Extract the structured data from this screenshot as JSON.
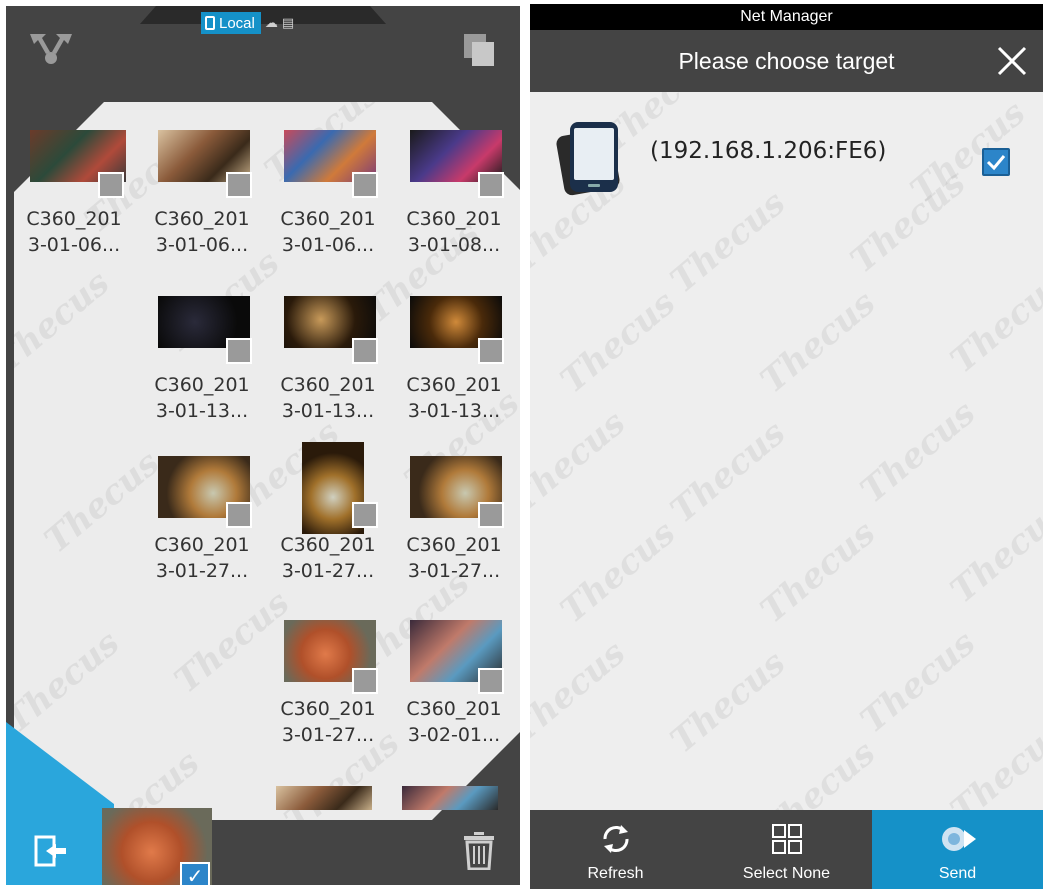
{
  "left_panel": {
    "source_tabs": {
      "local_label": "Local"
    },
    "thumbnails": [
      {
        "label": "C360_201\n3-01-06..."
      },
      {
        "label": "C360_201\n3-01-06..."
      },
      {
        "label": "C360_201\n3-01-06..."
      },
      {
        "label": "C360_201\n3-01-08..."
      },
      {
        "label": "C360_201\n3-01-13..."
      },
      {
        "label": "C360_201\n3-01-13..."
      },
      {
        "label": "C360_201\n3-01-13..."
      },
      {
        "label": "C360_201\n3-01-27..."
      },
      {
        "label": "C360_201\n3-01-27..."
      },
      {
        "label": "C360_201\n3-01-27..."
      },
      {
        "label": "C360_201\n3-01-27..."
      },
      {
        "label": "C360_201\n3-02-01..."
      }
    ],
    "accent_color": "#1591c8"
  },
  "right_panel": {
    "status_bar_title": "Net Manager",
    "dialog_title": "Please choose target",
    "devices": [
      {
        "address": "(192.168.1.206:FE6)",
        "checked": true
      }
    ],
    "actions": {
      "refresh_label": "Refresh",
      "select_none_label": "Select None",
      "send_label": "Send"
    }
  },
  "watermark_text": "Thecus",
  "icons": [
    "local-device-icon",
    "cloud-icon",
    "network-icon",
    "share-icon",
    "copy-icon",
    "exit-icon",
    "trash-icon",
    "close-icon",
    "phone-device-icon",
    "checkbox-icon",
    "refresh-icon",
    "select-none-icon",
    "send-icon"
  ]
}
